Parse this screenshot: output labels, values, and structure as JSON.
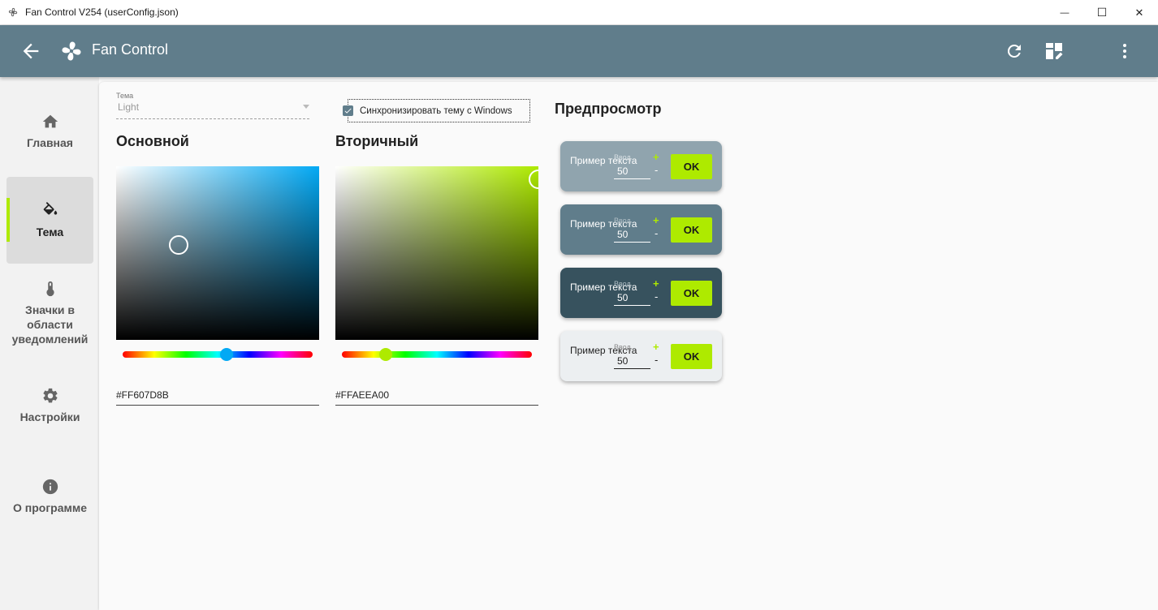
{
  "window": {
    "title": "Fan Control V254 (userConfig.json)",
    "controls": {
      "minimize": "—",
      "maximize": "☐",
      "close": "✕"
    }
  },
  "header": {
    "app_title": "Fan Control"
  },
  "sidebar": {
    "items": [
      {
        "label": "Главная",
        "icon": "home-icon"
      },
      {
        "label": "Тема",
        "icon": "paint-bucket-icon",
        "active": true
      },
      {
        "label": "Значки в области уведомлений",
        "icon": "thermometer-icon"
      },
      {
        "label": "Настройки",
        "icon": "gear-icon"
      },
      {
        "label": "О программе",
        "icon": "info-icon"
      }
    ]
  },
  "theme": {
    "select_caption": "Тема",
    "select_value": "Light",
    "sync_label": "Синхронизировать тему с Windows",
    "sync_checked": true
  },
  "primary": {
    "title": "Основной",
    "hex": "#FF607D8B",
    "hue_color": "#03a9f4"
  },
  "secondary": {
    "title": "Вторичный",
    "hex": "#FFAEEA00",
    "hue_color": "#aeea00"
  },
  "preview": {
    "title": "Предпросмотр",
    "text": "Пример текста",
    "input_caption": "Ввод",
    "input_value": "50",
    "plus": "+",
    "minus": "-",
    "ok": "OK",
    "card_colors": [
      "#90a4ae",
      "#607d8b",
      "#37525e",
      "#eceff1"
    ]
  }
}
